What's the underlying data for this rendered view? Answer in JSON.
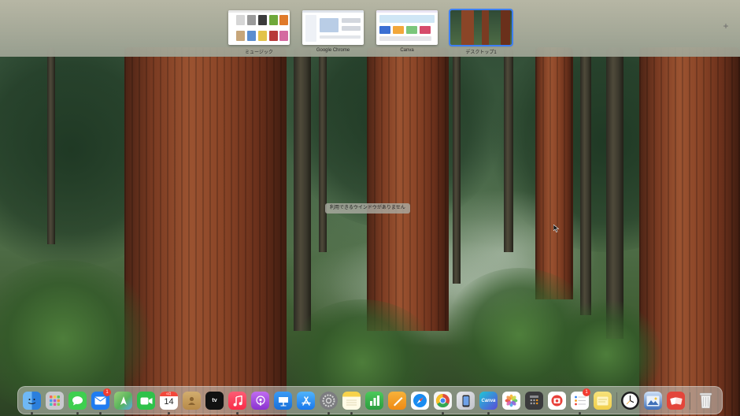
{
  "mission_control": {
    "spaces": [
      {
        "label": "ミュージック",
        "thumb": "music-window-thumbnail",
        "active": false
      },
      {
        "label": "Google Chrome",
        "thumb": "chrome-window-thumbnail",
        "active": false
      },
      {
        "label": "Canva",
        "thumb": "canva-window-thumbnail",
        "active": false
      },
      {
        "label": "デスクトップ1",
        "thumb": "desktop-wallpaper-thumbnail",
        "active": true
      }
    ],
    "add_space_icon": "plus-icon"
  },
  "desktop": {
    "empty_message": "利用できるウインドウがありません"
  },
  "dock": {
    "calendar": {
      "month": "6月",
      "day": "14"
    },
    "mail_badge": "1",
    "reminders_badge": "1",
    "apps": [
      {
        "name": "finder-icon",
        "color": "#2b8de6"
      },
      {
        "name": "launchpad-icon",
        "color": "#c7c7cc"
      },
      {
        "name": "messages-icon",
        "color": "#3ecf4f"
      },
      {
        "name": "mail-icon",
        "color": "#1f7cf0"
      },
      {
        "name": "maps-icon",
        "color": "#58b45a"
      },
      {
        "name": "facetime-icon",
        "color": "#2ec24a"
      },
      {
        "name": "calendar-icon",
        "color": "#ffffff"
      },
      {
        "name": "contacts-icon",
        "color": "#c29a5a"
      },
      {
        "name": "apple-tv-icon",
        "color": "#111111"
      },
      {
        "name": "music-icon",
        "color": "#fa2d48"
      },
      {
        "name": "podcasts-icon",
        "color": "#9b3fd6"
      },
      {
        "name": "keynote-icon",
        "color": "#1a86e8"
      },
      {
        "name": "app-store-icon",
        "color": "#1a86f0"
      },
      {
        "name": "system-settings-icon",
        "color": "#7c7c80"
      },
      {
        "name": "notes-icon",
        "color": "#f7d24a"
      },
      {
        "name": "numbers-icon",
        "color": "#34b04a"
      },
      {
        "name": "pages-icon",
        "color": "#f29a1c"
      },
      {
        "name": "safari-icon",
        "color": "#1a8cf0"
      },
      {
        "name": "chrome-icon",
        "color": "#ffffff"
      },
      {
        "name": "iphone-mirroring-icon",
        "color": "#dcdcdc"
      },
      {
        "name": "canva-icon",
        "color": "#18b6d2"
      },
      {
        "name": "photos-icon",
        "color": "#ffffff"
      },
      {
        "name": "calculator-icon",
        "color": "#3a3a3c"
      },
      {
        "name": "photo-booth-icon",
        "color": "#ffffff"
      },
      {
        "name": "reminders-icon",
        "color": "#ffffff"
      },
      {
        "name": "stickies-icon",
        "color": "#f6e27a"
      },
      {
        "name": "clock-icon",
        "color": "#ffffff"
      },
      {
        "name": "preview-icon",
        "color": "#3e6fb8"
      },
      {
        "name": "photo-slideshow-icon",
        "color": "#e3453a"
      },
      {
        "name": "trash-icon",
        "color": "#e6e6e6"
      }
    ]
  }
}
